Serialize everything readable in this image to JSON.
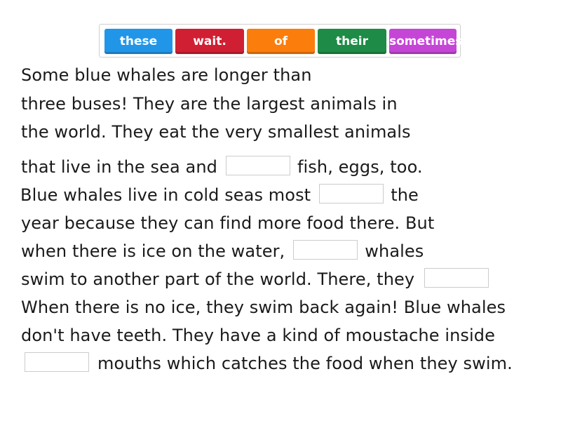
{
  "word_bank": {
    "chips": [
      {
        "label": "these",
        "color": "#2196e8"
      },
      {
        "label": "wait.",
        "color": "#d01f33"
      },
      {
        "label": "of",
        "color": "#fb7d0b"
      },
      {
        "label": "their",
        "color": "#1e8b46"
      },
      {
        "label": "sometimes",
        "color": "#c546d6"
      }
    ]
  },
  "passage": {
    "lines": [
      {
        "text": "Some blue whales are longer than"
      },
      {
        "text": "three buses! They are the largest animals in"
      },
      {
        "text": "the world. They eat the very smallest animals"
      },
      {
        "before": "that live in the sea and",
        "after": "fish, eggs, too."
      },
      {
        "before": "Blue whales live in cold seas most",
        "after": "the"
      },
      {
        "text": "year because they can find more food there. But"
      },
      {
        "before": "when there is ice on the water,",
        "after": "whales"
      },
      {
        "before": "swim to another part of the world. There, they",
        "after": ""
      },
      {
        "text": "When there is no ice, they swim back again! Blue whales"
      },
      {
        "text": "don't have teeth. They have a kind of moustache inside"
      },
      {
        "before": "",
        "after": "mouths which catches the food when they swim."
      }
    ],
    "blanks": [
      "",
      "",
      "",
      "",
      ""
    ]
  }
}
